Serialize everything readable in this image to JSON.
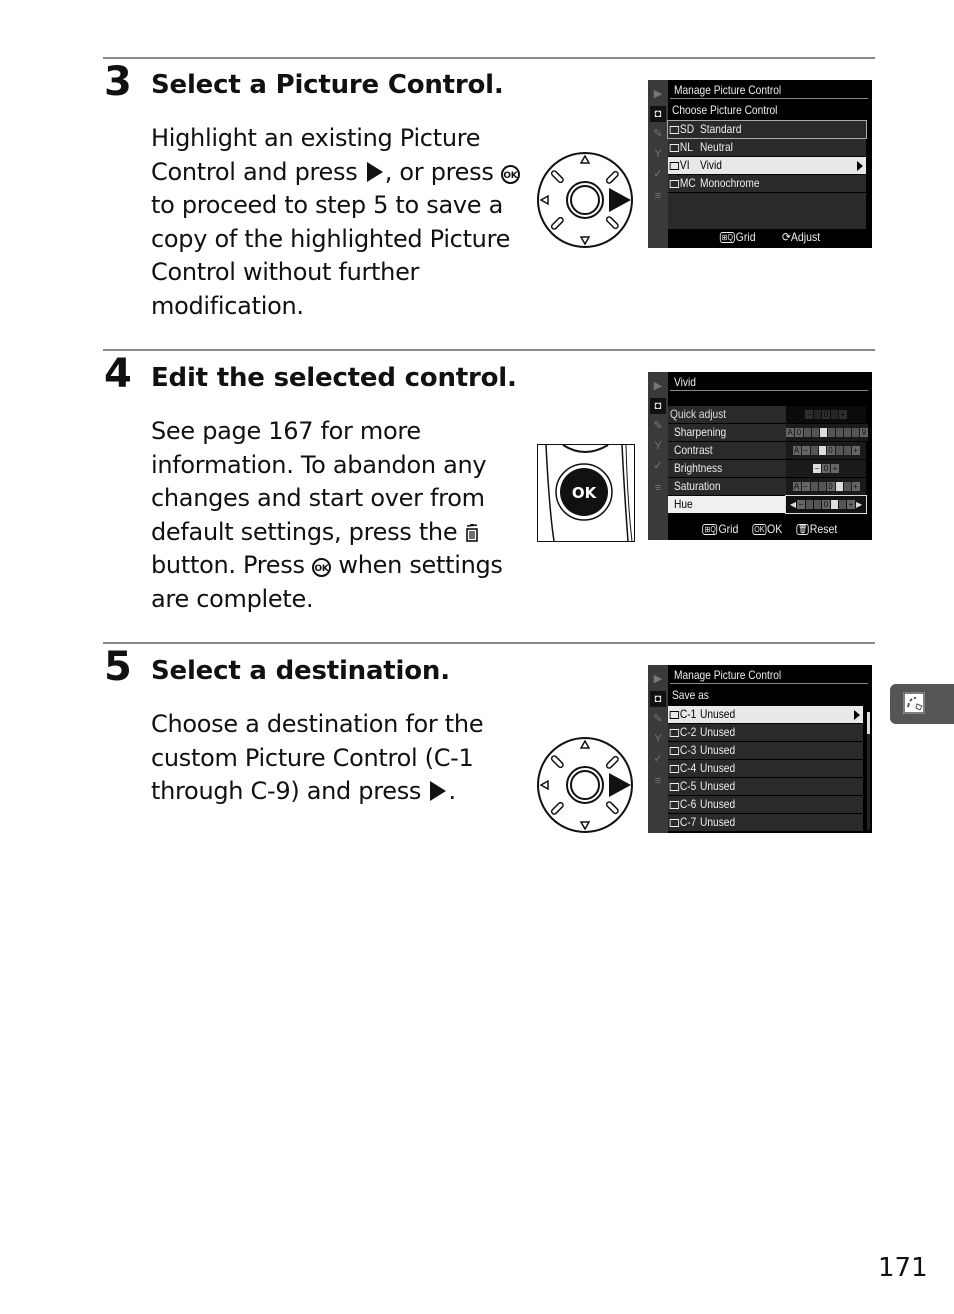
{
  "steps": [
    {
      "number": "3",
      "title": "Select a Picture Control.",
      "body": {
        "p1": "Highlight an existing Picture Control and press",
        "p2": ", or press",
        "p3": "to proceed to step 5 to save a copy of the highlighted Picture Control without further modification."
      },
      "illustration": "multi-selector-right",
      "screen": {
        "title": "Manage Picture Control",
        "subtitle": "Choose Picture Control",
        "items": [
          {
            "code": "SD",
            "label": "Standard",
            "state": "framed"
          },
          {
            "code": "NL",
            "label": "Neutral",
            "state": ""
          },
          {
            "code": "VI",
            "label": "Vivid",
            "state": "selected"
          },
          {
            "code": "MC",
            "label": "Monochrome",
            "state": ""
          }
        ],
        "footer": [
          {
            "icon": "zoom-out-icon",
            "label": "Grid"
          },
          {
            "icon": "command-dial-icon",
            "label": "Adjust"
          }
        ]
      }
    },
    {
      "number": "4",
      "title": "Edit the selected control.",
      "body": {
        "p1": "See page 167 for more information.  To abandon any changes and start over from default settings, press the",
        "p2": "button.  Press",
        "p3": "when settings are complete."
      },
      "illustration": "ok-button",
      "ok_label": "OK",
      "screen": {
        "title": "Vivid",
        "rows": [
          {
            "label": "Quick adjust",
            "value": "0",
            "range": "-..+",
            "state": "dimmed"
          },
          {
            "label": "Sharpening",
            "value": "3",
            "range": "A 0..9"
          },
          {
            "label": "Contrast",
            "value": "0",
            "range": "A -..+"
          },
          {
            "label": "Brightness",
            "value": "0",
            "range": "-..+"
          },
          {
            "label": "Saturation",
            "value": "0",
            "range": "A -..+"
          },
          {
            "label": "Hue",
            "value": "0",
            "range": "-..+",
            "state": "selected"
          }
        ],
        "footer": [
          {
            "icon": "zoom-out-icon",
            "label": "Grid"
          },
          {
            "icon": "ok-icon",
            "label": "OK"
          },
          {
            "icon": "trash-icon",
            "label": "Reset"
          }
        ]
      }
    },
    {
      "number": "5",
      "title": "Select a destination.",
      "body": {
        "p1": "Choose a destination for the custom Picture Control (C-1 through C-9) and press",
        "p2": "."
      },
      "illustration": "multi-selector-right",
      "screen": {
        "title": "Manage Picture Control",
        "subtitle": "Save as",
        "items": [
          {
            "code": "C-1",
            "label": "Unused",
            "state": "selected"
          },
          {
            "code": "C-2",
            "label": "Unused",
            "state": ""
          },
          {
            "code": "C-3",
            "label": "Unused",
            "state": ""
          },
          {
            "code": "C-4",
            "label": "Unused",
            "state": ""
          },
          {
            "code": "C-5",
            "label": "Unused",
            "state": ""
          },
          {
            "code": "C-6",
            "label": "Unused",
            "state": ""
          },
          {
            "code": "C-7",
            "label": "Unused",
            "state": ""
          }
        ]
      }
    }
  ],
  "ok_glyph": "OK",
  "side_tab": {
    "icon": "picture-control-icon"
  },
  "page_number": "171"
}
